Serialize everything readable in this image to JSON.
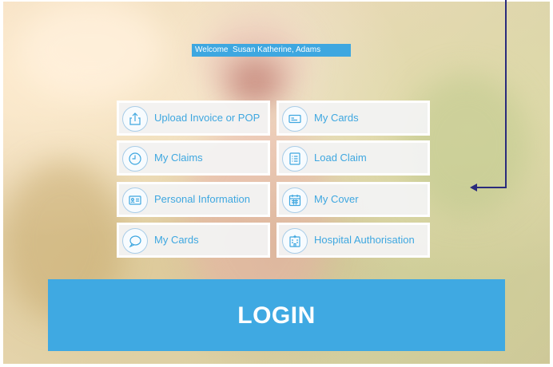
{
  "welcome": {
    "text": "Welcome  Susan Katherine, Adams"
  },
  "tiles": [
    {
      "label": "Upload Invoice or POP",
      "icon": "upload-icon"
    },
    {
      "label": "My Cards",
      "icon": "card-icon"
    },
    {
      "label": "My Claims",
      "icon": "clock-icon"
    },
    {
      "label": "Load Claim",
      "icon": "list-icon"
    },
    {
      "label": "Personal Information",
      "icon": "id-card-icon"
    },
    {
      "label": "My Cover",
      "icon": "calendar-icon"
    },
    {
      "label": "My Cards",
      "icon": "chat-icon"
    },
    {
      "label": "Hospital Authorisation",
      "icon": "hospital-icon"
    }
  ],
  "login": {
    "label": "LOGIN"
  },
  "colors": {
    "accent": "#3ea7e0",
    "arrow": "#2a2b7c",
    "tile_bg": "#f3f3f3"
  }
}
